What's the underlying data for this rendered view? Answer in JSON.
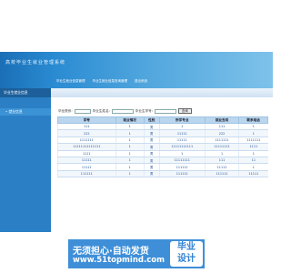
{
  "app": {
    "title": "高校毕业生就业管理系统"
  },
  "top_nav": [
    "毕业生就业信息管理",
    "毕业生就业信息查询管理",
    "退出系统"
  ],
  "sidebar": {
    "header": "毕业生就业信息",
    "items": [
      "• 就业信息"
    ]
  },
  "search": {
    "label_department": "毕业院系:",
    "department_value": "",
    "label_name": "毕业生姓名:",
    "name_value": "",
    "label_id": "毕业生学号:",
    "id_value": "",
    "button": "查询"
  },
  "table": {
    "headers": [
      "学号",
      "就业情况",
      "性别",
      "所学专业",
      "就业去向",
      "联系电话"
    ],
    "rows": [
      [
        "111",
        "1",
        "男",
        "1",
        "111",
        "1"
      ],
      [
        "222",
        "1",
        "男",
        "11111",
        "222",
        "1"
      ],
      [
        "1111111",
        "1",
        "男",
        "11111",
        "1111111",
        "1111111"
      ],
      [
        "11111111111111",
        "1",
        "男",
        "11111111111",
        "11111111",
        "1111"
      ],
      [
        "1111",
        "1",
        "男",
        "1",
        "1",
        "1"
      ],
      [
        "11111",
        "1",
        "男",
        "11111111",
        "111",
        "11"
      ],
      [
        "11111",
        "1",
        "男",
        "111111",
        "11111",
        "1"
      ],
      [
        "111111",
        "1",
        "男",
        "111111",
        "111111",
        "11111"
      ]
    ]
  },
  "ad": {
    "line1": "无须担心·自动发货",
    "line2": "www.51topmind.com",
    "badge_line1": "毕业",
    "badge_line2": "设计"
  }
}
